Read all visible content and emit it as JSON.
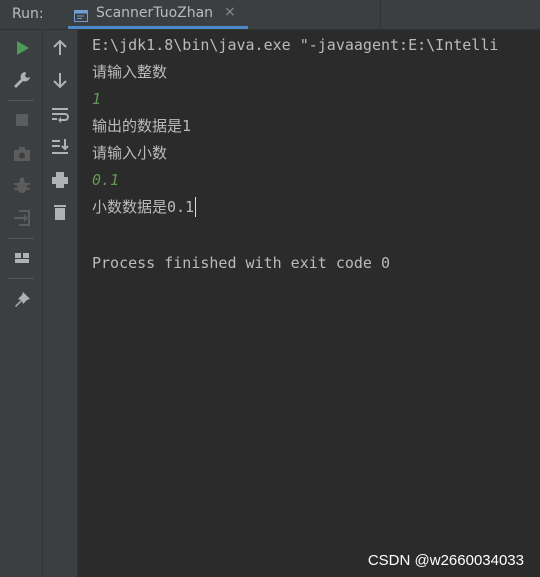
{
  "toolbar": {
    "run_label": "Run:",
    "tab_title": "ScannerTuoZhan",
    "tab_close": "×"
  },
  "console": {
    "lines": [
      {
        "text": "E:\\jdk1.8\\bin\\java.exe \"-javaagent:E:\\Intelli",
        "kind": "output"
      },
      {
        "text": "请输入整数",
        "kind": "output"
      },
      {
        "text": "1",
        "kind": "input"
      },
      {
        "text": "输出的数据是1",
        "kind": "output"
      },
      {
        "text": "请输入小数",
        "kind": "output"
      },
      {
        "text": "0.1",
        "kind": "input"
      },
      {
        "text": "小数数据是0.1",
        "kind": "output"
      },
      {
        "text": "",
        "kind": "output"
      },
      {
        "text": "Process finished with exit code 0",
        "kind": "output"
      }
    ]
  },
  "left_toolbar": {
    "icons": [
      "run-icon",
      "wrench-icon",
      "stop-icon",
      "camera-icon",
      "debug-icon",
      "exit-icon",
      "layout-icon",
      "pin-icon"
    ]
  },
  "console_toolbar": {
    "icons": [
      "arrow-up-icon",
      "arrow-down-icon",
      "soft-wrap-icon",
      "scroll-to-end-icon",
      "print-icon",
      "trash-icon"
    ]
  },
  "watermark": "CSDN @w2660034033",
  "colors": {
    "background": "#2b2b2b",
    "toolbar": "#3c3f41",
    "text": "#bbbbbb",
    "input_text": "#629755",
    "accent": "#4a88c7",
    "run_green": "#499c54"
  }
}
